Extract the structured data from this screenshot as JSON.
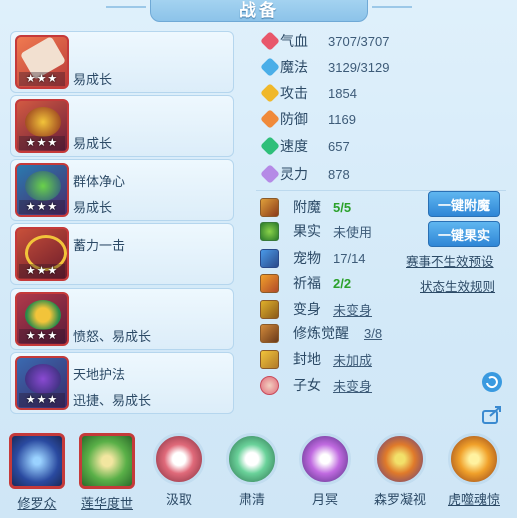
{
  "title": "战备",
  "equipment": [
    {
      "stars": "★★★",
      "line1": "易成长",
      "line2": ""
    },
    {
      "stars": "★★★",
      "line1": "易成长",
      "line2": ""
    },
    {
      "stars": "★★★",
      "line1": "群体净心",
      "line2": "易成长"
    },
    {
      "stars": "★★★",
      "line1": "蓄力一击",
      "line2": ""
    },
    {
      "stars": "★★★",
      "line1": "愤怒、易成长",
      "line2": ""
    },
    {
      "stars": "★★★",
      "line1": "天地护法",
      "line2": "迅捷、易成长"
    }
  ],
  "stats": [
    {
      "label": "气血",
      "value": "3707/3707",
      "color": "#e8576b"
    },
    {
      "label": "魔法",
      "value": "3129/3129",
      "color": "#4aaee8"
    },
    {
      "label": "攻击",
      "value": "1854",
      "color": "#f0b82a"
    },
    {
      "label": "防御",
      "value": "1169",
      "color": "#f08a3a"
    },
    {
      "label": "速度",
      "value": "657",
      "color": "#2fbf7a"
    },
    {
      "label": "灵力",
      "value": "878",
      "color": "#b58ae6"
    }
  ],
  "features": [
    {
      "label": "附魔",
      "value": "5/5"
    },
    {
      "label": "果实",
      "value": "未使用"
    },
    {
      "label": "宠物",
      "value": "17/14"
    },
    {
      "label": "祈福",
      "value": "2/2"
    },
    {
      "label": "变身",
      "value": "未变身"
    },
    {
      "label": "修炼觉醒",
      "value": "3/8"
    },
    {
      "label": "封地",
      "value": "未加成"
    },
    {
      "label": "子女",
      "value": "未变身"
    }
  ],
  "buttons": {
    "enchant": "一键附魔",
    "fruit": "一键果实"
  },
  "links": {
    "preset": "赛事不生效预设",
    "rules": "状态生效规则"
  },
  "skills": [
    {
      "name": "修罗众",
      "color": "#3b6fe0"
    },
    {
      "name": "莲华度世",
      "color": "#5ab048"
    },
    {
      "name": "汲取",
      "color": "#d24a5a"
    },
    {
      "name": "肃清",
      "color": "#3aa06a"
    },
    {
      "name": "月冥",
      "color": "#b04ad2"
    },
    {
      "name": "森罗凝视",
      "color": "#e07a2a"
    },
    {
      "name": "虎噬魂惊",
      "color": "#e0a02a"
    }
  ]
}
